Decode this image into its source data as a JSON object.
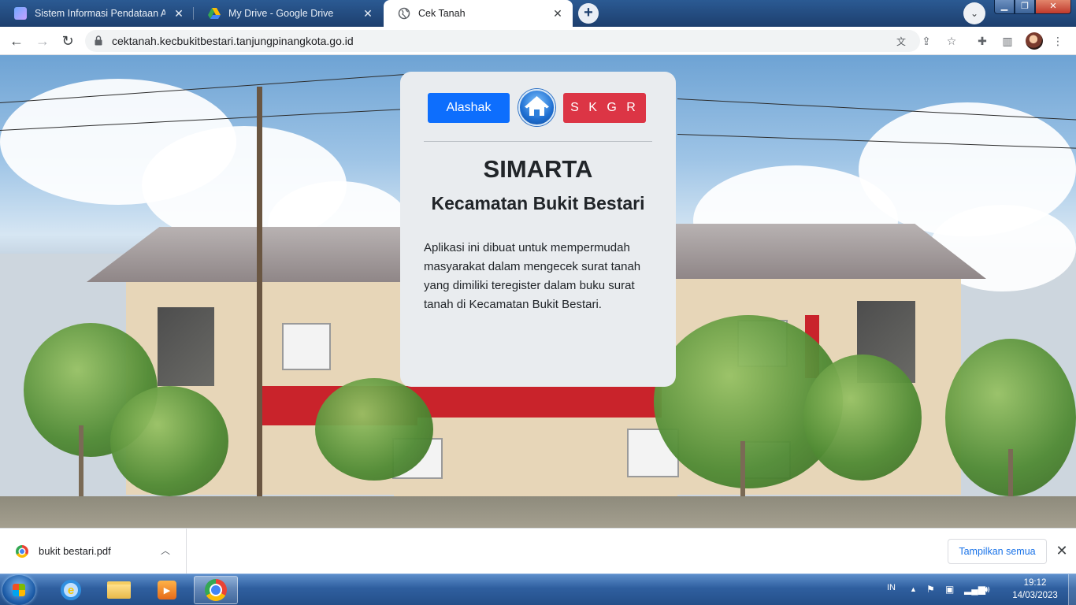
{
  "browser": {
    "tabs": [
      {
        "title": "Sistem Informasi Pendataan Aplikasi",
        "favicon": "form-favicon-icon",
        "active": false
      },
      {
        "title": "My Drive - Google Drive",
        "favicon": "google-drive-icon",
        "active": false
      },
      {
        "title": "Cek Tanah",
        "favicon": "globe-icon",
        "active": true
      }
    ],
    "url": "cektanah.kecbukitbestari.tanjungpinangkota.go.id"
  },
  "page": {
    "buttons": {
      "alashak": "Alashak",
      "skgr": "S K G R"
    },
    "title": "SIMARTA",
    "subtitle": "Kecamatan Bukit Bestari",
    "description": "Aplikasi ini dibuat untuk mempermudah masyarakat dalam mengecek surat tanah yang dimiliki teregister dalam buku surat tanah di Kecamatan Bukit Bestari.",
    "colors": {
      "alashak": "#0d6efd",
      "skgr": "#dc3545",
      "card": "#e9ecef"
    }
  },
  "downloads": {
    "file_name": "bukit bestari.pdf",
    "show_all": "Tampilkan semua"
  },
  "taskbar": {
    "language": "IN",
    "time": "19:12",
    "date": "14/03/2023"
  }
}
